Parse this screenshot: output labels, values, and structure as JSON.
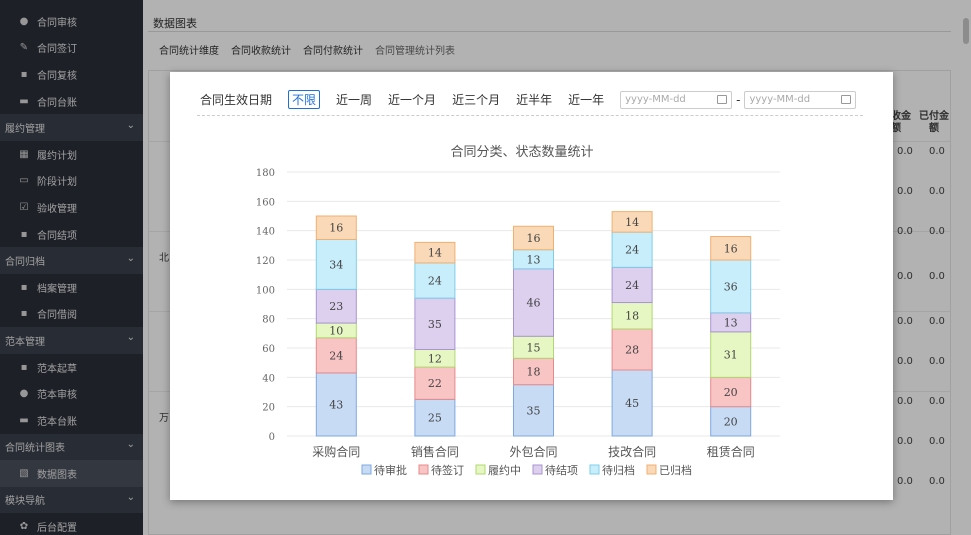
{
  "sidebar": {
    "items": [
      {
        "type": "item",
        "icon": "user-icon",
        "glyph": "●",
        "label": "合同审核"
      },
      {
        "type": "item",
        "icon": "pen-icon",
        "glyph": "✎",
        "label": "合同签订"
      },
      {
        "type": "item",
        "icon": "file-icon",
        "glyph": "▪",
        "label": "合同复核"
      },
      {
        "type": "item",
        "icon": "print-icon",
        "glyph": "▬",
        "label": "合同台账"
      },
      {
        "type": "group",
        "label": "履约管理"
      },
      {
        "type": "item",
        "icon": "calendar-icon",
        "glyph": "▦",
        "label": "履约计划"
      },
      {
        "type": "item",
        "icon": "window-icon",
        "glyph": "▭",
        "label": "阶段计划"
      },
      {
        "type": "item",
        "icon": "check-square-icon",
        "glyph": "☑",
        "label": "验收管理"
      },
      {
        "type": "item",
        "icon": "file-icon",
        "glyph": "▪",
        "label": "合同结项"
      },
      {
        "type": "group",
        "label": "合同归档"
      },
      {
        "type": "item",
        "icon": "archive-icon",
        "glyph": "▪",
        "label": "档案管理"
      },
      {
        "type": "item",
        "icon": "file-icon",
        "glyph": "▪",
        "label": "合同借阅"
      },
      {
        "type": "group",
        "label": "范本管理"
      },
      {
        "type": "item",
        "icon": "edit-icon",
        "glyph": "▪",
        "label": "范本起草"
      },
      {
        "type": "item",
        "icon": "user-icon",
        "glyph": "●",
        "label": "范本审核"
      },
      {
        "type": "item",
        "icon": "print-icon",
        "glyph": "▬",
        "label": "范本台账"
      },
      {
        "type": "group",
        "label": "合同统计图表"
      },
      {
        "type": "item",
        "icon": "chart-icon",
        "glyph": "▧",
        "label": "数据图表",
        "active": true
      },
      {
        "type": "group",
        "label": "模块导航"
      },
      {
        "type": "item",
        "icon": "gear-icon",
        "glyph": "✿",
        "label": "后台配置"
      }
    ]
  },
  "main": {
    "breadcrumb": "数据图表",
    "tabs": [
      "合同统计维度",
      "合同收款统计",
      "合同付款统计",
      "合同管理统计列表"
    ],
    "table_headers": [
      "收金额",
      "已付金额"
    ],
    "row_prefixes": [
      "北",
      "万"
    ],
    "cell_value": "0.0"
  },
  "modal": {
    "filter_label": "合同生效日期",
    "filter_options": [
      "不限",
      "近一周",
      "近一个月",
      "近三个月",
      "近半年",
      "近一年"
    ],
    "selected_option": "不限",
    "date_start_placeholder": "yyyy-MM-dd",
    "date_end_placeholder": "yyyy-MM-dd",
    "date_separator": "-"
  },
  "chart_data": {
    "type": "bar",
    "stacked": true,
    "title": "合同分类、状态数量统计",
    "categories": [
      "采购合同",
      "销售合同",
      "外包合同",
      "技改合同",
      "租赁合同"
    ],
    "ylim": [
      0,
      180
    ],
    "yticks": [
      0,
      20,
      40,
      60,
      80,
      100,
      120,
      140,
      160,
      180
    ],
    "grid": true,
    "legend_position": "bottom",
    "series": [
      {
        "name": "待审批",
        "values": [
          43,
          25,
          35,
          45,
          20
        ],
        "fill": "#c7dbf5",
        "stroke": "#7fa8e0"
      },
      {
        "name": "待签订",
        "values": [
          24,
          22,
          18,
          28,
          20
        ],
        "fill": "#f8c4c4",
        "stroke": "#e88a8a"
      },
      {
        "name": "履约中",
        "values": [
          10,
          12,
          15,
          18,
          31
        ],
        "fill": "#e6f7c4",
        "stroke": "#b0d870"
      },
      {
        "name": "待结项",
        "values": [
          23,
          35,
          46,
          24,
          13
        ],
        "fill": "#ddd0ef",
        "stroke": "#a994d2"
      },
      {
        "name": "待归档",
        "values": [
          34,
          24,
          13,
          24,
          36
        ],
        "fill": "#c8eefb",
        "stroke": "#7fcde8"
      },
      {
        "name": "已归档",
        "values": [
          16,
          14,
          16,
          14,
          16
        ],
        "fill": "#fad9b8",
        "stroke": "#f0b070"
      }
    ]
  }
}
